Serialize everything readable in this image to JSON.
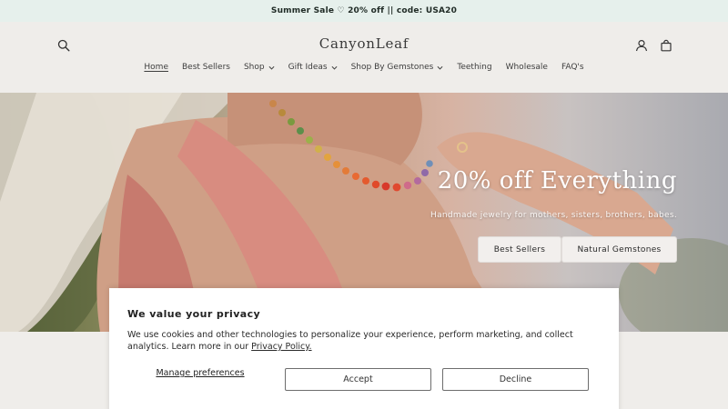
{
  "announcement": "Summer Sale ♡ 20% off || code: USA20",
  "brand": "CanyonLeaf",
  "header_icons": [
    "search-icon",
    "account-icon",
    "cart-icon"
  ],
  "nav": [
    {
      "label": "Home",
      "active": true,
      "dropdown": false
    },
    {
      "label": "Best Sellers",
      "active": false,
      "dropdown": false
    },
    {
      "label": "Shop",
      "active": false,
      "dropdown": true
    },
    {
      "label": "Gift Ideas",
      "active": false,
      "dropdown": true
    },
    {
      "label": "Shop By Gemstones",
      "active": false,
      "dropdown": true
    },
    {
      "label": "Teething",
      "active": false,
      "dropdown": false
    },
    {
      "label": "Wholesale",
      "active": false,
      "dropdown": false
    },
    {
      "label": "FAQ's",
      "active": false,
      "dropdown": false
    }
  ],
  "hero": {
    "title": "20% off Everything",
    "subtitle": "Handmade jewelry for mothers, sisters, brothers, babes.",
    "buttons": [
      "Best Sellers",
      "Natural Gemstones"
    ]
  },
  "cookie": {
    "title": "We value your privacy",
    "body": "We use cookies and other technologies to personalize your experience, perform marketing, and collect analytics. Learn more in our ",
    "link": "Privacy Policy.",
    "manage": "Manage preferences",
    "accept": "Accept",
    "decline": "Decline"
  },
  "colors": {
    "announcement_bg": "#e6f0ec",
    "page_bg": "#efedea",
    "button_bg": "#f2efed"
  }
}
